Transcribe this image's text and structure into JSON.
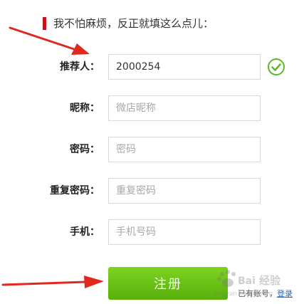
{
  "header": {
    "title": "我不怕麻烦，反正就填这么点儿："
  },
  "form": {
    "referrer": {
      "label": "推荐人：",
      "value": "2000254"
    },
    "nickname": {
      "label": "昵称：",
      "placeholder": "微店昵称"
    },
    "password": {
      "label": "密码：",
      "placeholder": "密码"
    },
    "confirm_password": {
      "label": "重复密码：",
      "placeholder": "重复密码"
    },
    "phone": {
      "label": "手机：",
      "placeholder": "手机号码"
    }
  },
  "actions": {
    "register_label": "注册"
  },
  "footer": {
    "hint_text": "已有账号，",
    "login_label": "登录"
  },
  "watermark": {
    "line1": "Bai",
    "line2": "经验",
    "line3": "jingyan.baidu.com"
  },
  "colors": {
    "accent_red": "#c4141b",
    "button_green": "#6cc516",
    "check_green": "#5cb82a",
    "arrow_red": "#e0281e"
  }
}
